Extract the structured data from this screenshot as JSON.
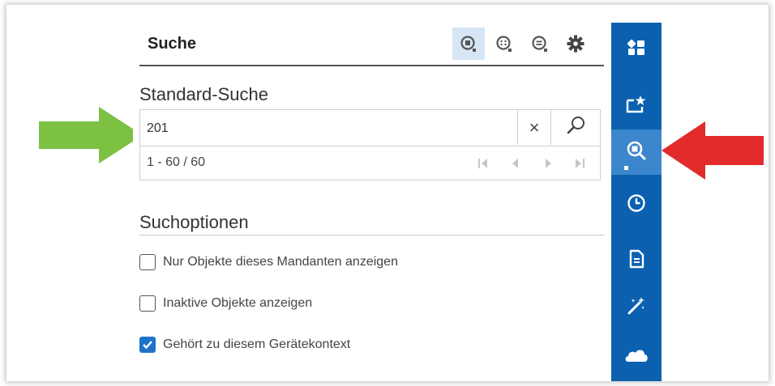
{
  "panel": {
    "title": "Suche",
    "header_icons": [
      "standard-search-icon",
      "extended-search-icon",
      "filter-search-icon",
      "settings-icon"
    ]
  },
  "standard_search": {
    "title": "Standard-Suche",
    "query": "201",
    "clear_label": "×",
    "result_range": "1 - 60 / 60"
  },
  "search_options": {
    "title": "Suchoptionen",
    "items": [
      {
        "label": "Nur Objekte dieses Mandanten anzeigen",
        "checked": false
      },
      {
        "label": "Inaktive Objekte anzeigen",
        "checked": false
      },
      {
        "label": "Gehört zu diesem Gerätekontext",
        "checked": true
      }
    ]
  },
  "sidebar": {
    "items": [
      "dashboard-icon",
      "favorites-icon",
      "search-icon",
      "history-icon",
      "document-icon",
      "magic-wand-icon",
      "cloud-icon"
    ],
    "active_index": 2
  },
  "colors": {
    "sidebar_bg": "#0b61b0",
    "sidebar_active": "#3b86cc",
    "header_active": "#d7e6f4",
    "checkbox_checked": "#1e73c8",
    "green_arrow": "#7cc142",
    "red_arrow": "#e32b2b"
  }
}
